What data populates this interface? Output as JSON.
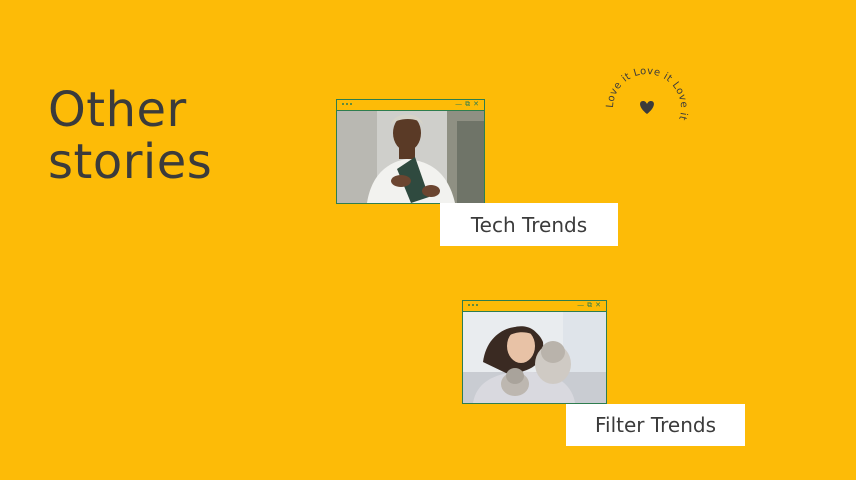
{
  "heading": {
    "line1": "Other",
    "line2": "stories"
  },
  "stories": [
    {
      "label": "Tech Trends",
      "image": "woman-with-smartphone-photo"
    },
    {
      "label": "Filter Trends",
      "image": "woman-with-cats-photo"
    }
  ],
  "window_controls": {
    "minimize": "—",
    "restore": "⧉",
    "close": "✕"
  },
  "badge": {
    "text": "Love it  Love it  Love it  ",
    "icon": "heart-icon"
  },
  "colors": {
    "background": "#FDBB07",
    "text": "#3B3B3B",
    "frame": "#2E7D4F",
    "label_bg": "#FFFFFF"
  }
}
